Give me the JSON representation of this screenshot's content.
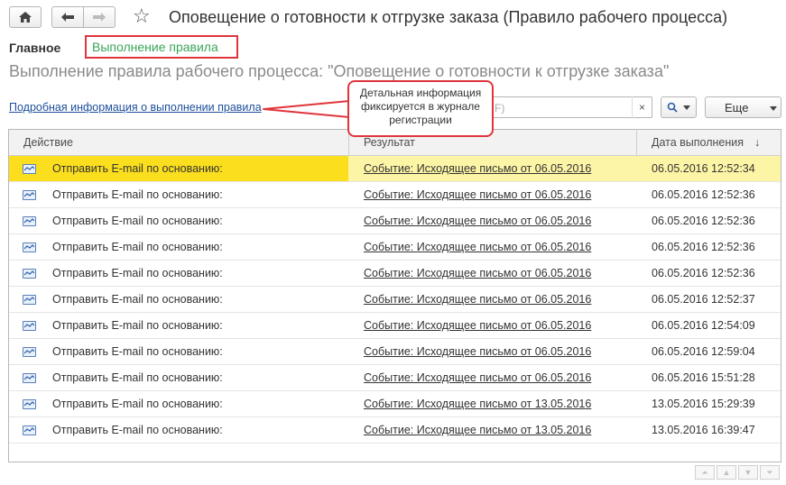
{
  "window": {
    "title": "Оповещение о готовности к отгрузке заказа (Правило рабочего процесса)"
  },
  "toolbar": {
    "home_icon": "home-icon",
    "back_icon": "arrow-left-icon",
    "forward_icon": "arrow-right-icon",
    "favorite_icon": "star-icon"
  },
  "tabs": {
    "main_label": "Главное",
    "active_label": "Выполнение правила"
  },
  "page": {
    "subtitle": "Выполнение правила рабочего процесса: \"Оповещение о готовности к отгрузке заказа\"",
    "details_link": "Подробная информация о выполнении правила"
  },
  "search": {
    "placeholder_visible": "F)",
    "clear_label": "×",
    "search_icon": "search-icon",
    "more_label": "Еще"
  },
  "callout": {
    "text": "Детальная информация фиксируется в журнале регистрации"
  },
  "table": {
    "columns": [
      "Действие",
      "Результат",
      "Дата выполнения"
    ],
    "sort_indicator": "↓",
    "rows": [
      {
        "action": "Отправить E-mail по основанию:",
        "result": "Событие: Исходящее письмо от 06.05.2016",
        "date": "06.05.2016 12:52:34",
        "selected": true
      },
      {
        "action": "Отправить E-mail по основанию:",
        "result": "Событие: Исходящее письмо от 06.05.2016",
        "date": "06.05.2016 12:52:36"
      },
      {
        "action": "Отправить E-mail по основанию:",
        "result": "Событие: Исходящее письмо от 06.05.2016",
        "date": "06.05.2016 12:52:36"
      },
      {
        "action": "Отправить E-mail по основанию:",
        "result": "Событие: Исходящее письмо от 06.05.2016",
        "date": "06.05.2016 12:52:36"
      },
      {
        "action": "Отправить E-mail по основанию:",
        "result": "Событие: Исходящее письмо от 06.05.2016",
        "date": "06.05.2016 12:52:36"
      },
      {
        "action": "Отправить E-mail по основанию:",
        "result": "Событие: Исходящее письмо от 06.05.2016",
        "date": "06.05.2016 12:52:37"
      },
      {
        "action": "Отправить E-mail по основанию:",
        "result": "Событие: Исходящее письмо от 06.05.2016",
        "date": "06.05.2016 12:54:09"
      },
      {
        "action": "Отправить E-mail по основанию:",
        "result": "Событие: Исходящее письмо от 06.05.2016",
        "date": "06.05.2016 12:59:04"
      },
      {
        "action": "Отправить E-mail по основанию:",
        "result": "Событие: Исходящее письмо от 06.05.2016",
        "date": "06.05.2016 15:51:28"
      },
      {
        "action": "Отправить E-mail по основанию:",
        "result": "Событие: Исходящее письмо от 13.05.2016",
        "date": "13.05.2016 15:29:39"
      },
      {
        "action": "Отправить E-mail по основанию:",
        "result": "Событие: Исходящее письмо от 13.05.2016",
        "date": "13.05.2016 16:39:47"
      }
    ]
  },
  "pager": {
    "first": "⏶",
    "prev": "▲",
    "next": "▼",
    "last": "⏷"
  },
  "colors": {
    "selected_row": "#fdf5a6",
    "selected_cell": "#fbdf1e",
    "highlight_border": "#e0343c",
    "active_tab_text": "#3aa557",
    "link": "#1d4f9c"
  }
}
